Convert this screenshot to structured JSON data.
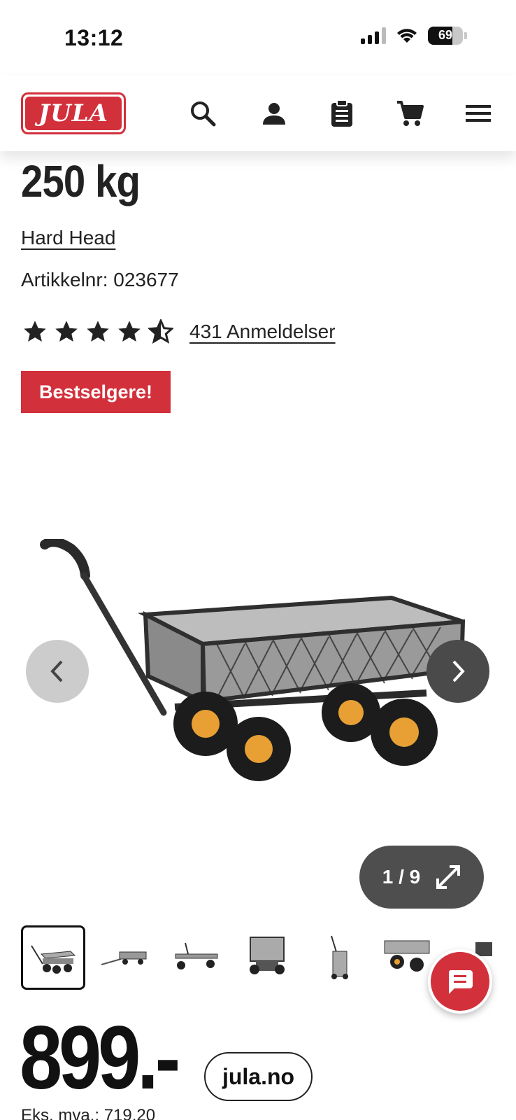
{
  "status_bar": {
    "time": "13:12",
    "battery": "69",
    "battery_level": 0.69
  },
  "header": {
    "logo_text": "JULA",
    "icons": [
      "search-icon",
      "account-icon",
      "shopping-list-icon",
      "cart-icon",
      "menu-icon"
    ]
  },
  "product": {
    "title": "250 kg",
    "brand": "Hard Head",
    "sku": "Artikkelnr: 023677",
    "rating": 4.5,
    "rating_max": 5,
    "reviews": "431 Anmeldelser",
    "badge": "Bestselgere!"
  },
  "gallery": {
    "counter": "1 / 9",
    "thumbnail_count": 7,
    "active_thumbnail": 0
  },
  "price": {
    "amount": "899.-",
    "vat_note": "Eks. mva.: 719,20"
  },
  "footer": {
    "domain": "jula.no"
  },
  "colors": {
    "brand_red": "#d2303b",
    "wheel_orange": "#e8a035"
  }
}
